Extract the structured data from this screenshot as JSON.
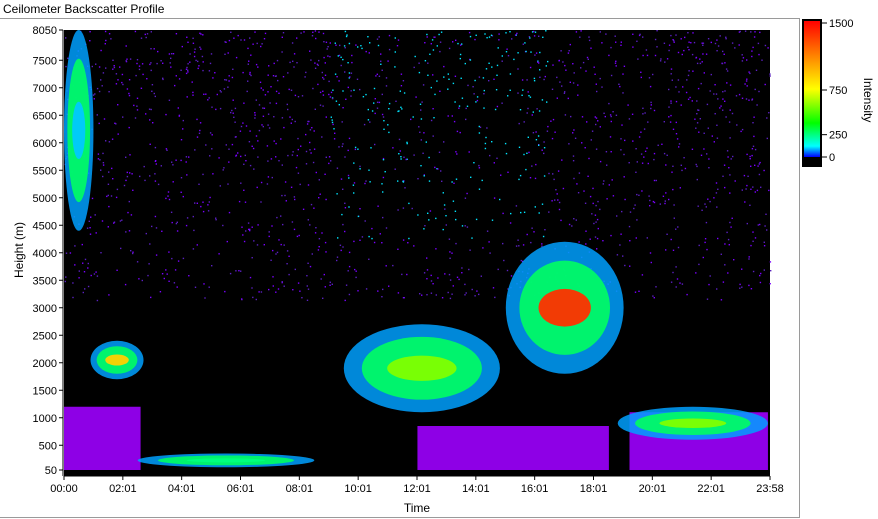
{
  "title": "Ceilometer Backscatter Profile",
  "chart_data": {
    "type": "heatmap",
    "xlabel": "Time",
    "ylabel": "Height (m)",
    "x_ticks": [
      "00:00",
      "02:01",
      "04:01",
      "06:01",
      "08:01",
      "10:01",
      "12:01",
      "14:01",
      "16:01",
      "18:01",
      "20:01",
      "22:01",
      "23:58"
    ],
    "x_range_hours": [
      0,
      23.97
    ],
    "y_ticks": [
      50,
      500,
      1000,
      1500,
      2000,
      2500,
      3000,
      3500,
      4000,
      4500,
      5000,
      5500,
      6000,
      6500,
      7000,
      7500,
      8050
    ],
    "y_range": [
      50,
      8050
    ],
    "colorbar": {
      "label": "Intensity",
      "ticks": [
        0,
        250,
        750,
        1500
      ],
      "range": [
        0,
        1500
      ]
    },
    "colorscale": [
      "#000000",
      "#7a00ff",
      "#00ffff",
      "#00ff00",
      "#ffff00",
      "#ff8000",
      "#ff0000"
    ],
    "features": [
      {
        "name": "surface_layer",
        "x": [
          0,
          2.6
        ],
        "y": [
          50,
          1200
        ],
        "intensity": 180
      },
      {
        "name": "surface_layer",
        "x": [
          12,
          18.5
        ],
        "y": [
          50,
          850
        ],
        "intensity": 180
      },
      {
        "name": "surface_layer",
        "x": [
          19.2,
          23.9
        ],
        "y": [
          50,
          1100
        ],
        "intensity": 180
      },
      {
        "name": "cloud_layer",
        "x": [
          0.9,
          2.7
        ],
        "y": [
          1700,
          2400
        ],
        "intensity": 900
      },
      {
        "name": "cloud_layer",
        "x": [
          15,
          19
        ],
        "y": [
          1800,
          4200
        ],
        "intensity": 1200
      },
      {
        "name": "cloud_layer",
        "x": [
          9.5,
          14.8
        ],
        "y": [
          1100,
          2700
        ],
        "intensity": 800
      },
      {
        "name": "cloud_layer",
        "x": [
          18.8,
          23.9
        ],
        "y": [
          600,
          1200
        ],
        "intensity": 700
      },
      {
        "name": "low_cloud",
        "x": [
          2.5,
          8.5
        ],
        "y": [
          100,
          350
        ],
        "intensity": 600
      },
      {
        "name": "high_cloud",
        "x": [
          0,
          1
        ],
        "y": [
          4400,
          8050
        ],
        "intensity": 300
      }
    ]
  }
}
